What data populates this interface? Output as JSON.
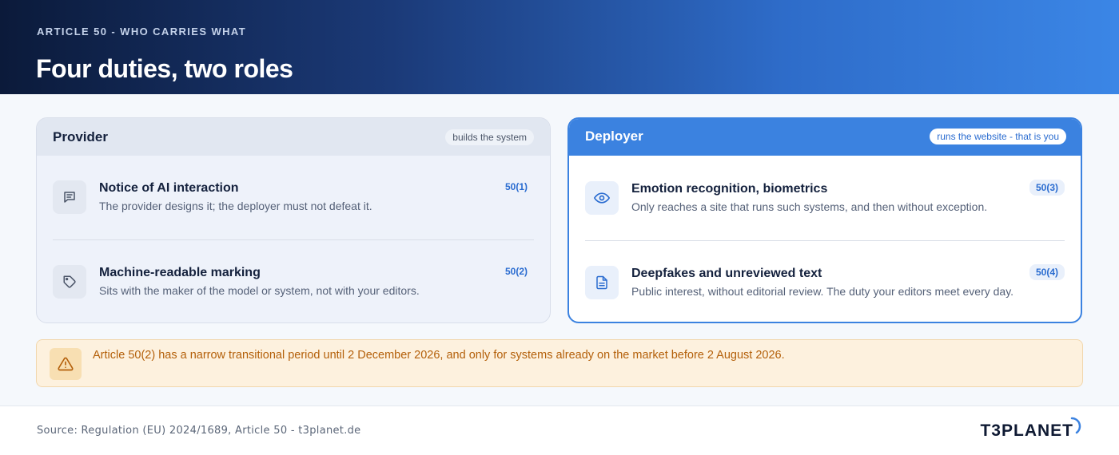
{
  "header": {
    "eyebrow": "ARTICLE 50 - WHO CARRIES WHAT",
    "title": "Four duties, two roles"
  },
  "provider": {
    "title": "Provider",
    "pill": "builds the system",
    "items": [
      {
        "icon": "chat-icon",
        "title": "Notice of AI interaction",
        "description": "The provider designs it; the deployer must not defeat it.",
        "ref": "50(1)"
      },
      {
        "icon": "tag-icon",
        "title": "Machine-readable marking",
        "description": "Sits with the maker of the model or system, not with your editors.",
        "ref": "50(2)"
      }
    ]
  },
  "deployer": {
    "title": "Deployer",
    "pill": "runs the website - that is you",
    "items": [
      {
        "icon": "eye-icon",
        "title": "Emotion recognition, biometrics",
        "description": "Only reaches a site that runs such systems, and then without exception.",
        "ref": "50(3)"
      },
      {
        "icon": "document-icon",
        "title": "Deepfakes and unreviewed text",
        "description": "Public interest, without editorial review. The duty your editors meet every day.",
        "ref": "50(4)"
      }
    ]
  },
  "note": {
    "icon": "warning-icon",
    "text": "Article 50(2) has a narrow transitional period until 2 December 2026, and only for systems already on the market before 2 August 2026."
  },
  "footer": {
    "source": "Source: Regulation (EU) 2024/1689, Article 50 - t3planet.de",
    "logo_text": "T3PLANET"
  },
  "colors": {
    "accent": "#3b82e0",
    "warning": "#b4600a"
  }
}
